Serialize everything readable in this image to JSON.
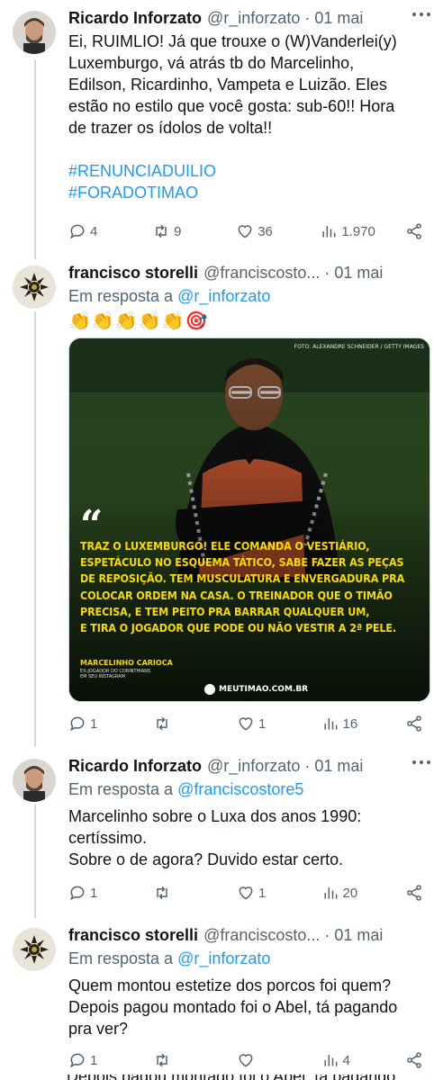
{
  "tweets": [
    {
      "name": "Ricardo Inforzato",
      "handle": "@r_inforzato",
      "date": "01 mai",
      "text": [
        "Ei, RUIMLIO! Já que trouxe o (W)Vanderlei(y)",
        "Luxemburgo, vá atrás tb do Marcelinho,",
        "Edilson, Ricardinho, Vampeta e Luizão. Eles",
        "estão no estilo que você gosta: sub-60!! Hora",
        "de trazer os ídolos de volta!!"
      ],
      "hashtags": [
        "#RENUNCIADUILIO",
        "#FORADOTIMAO"
      ],
      "replies": "4",
      "retweets": "9",
      "likes": "36",
      "views": "1.970"
    },
    {
      "name": "francisco storelli",
      "handle": "@franciscosto...",
      "date": "01 mai",
      "reply_prefix": "Em resposta a",
      "reply_to": "@r_inforzato",
      "emojis": [
        "👏",
        "👏",
        "👏",
        "👏",
        "👏",
        "🎯"
      ],
      "media": {
        "credit": "FOTO: ALEXANDRE SCHNEIDER / GETTY IMAGES",
        "quote_mark": "“",
        "quote_lines": [
          "TRAZ O LUXEMBURGO! ELE COMANDA O VESTIÁRIO,",
          "ESPETÁCULO NO ESQUEMA TÁTICO, SABE FAZER AS PEÇAS",
          "DE REPOSIÇÃO. TEM MUSCULATURA E ENVERGADURA PRA",
          "COLOCAR ORDEM NA CASA. O TREINADOR QUE O TIMÃO",
          "PRECISA, E TEM PEITO PRA BARRAR QUALQUER UM,",
          "E TIRA O JOGADOR QUE PODE OU NÃO VESTIR A 2ª PELE."
        ],
        "author": "MARCELINHO CARIOCA",
        "author_sub1": "EX-JOGADOR DO CORINTHIANS",
        "author_sub2": "EM SEU INSTAGRAM",
        "site": "MEUTIMAO.COM.BR"
      },
      "replies": "1",
      "retweets": "",
      "likes": "1",
      "views": "16"
    },
    {
      "name": "Ricardo Inforzato",
      "handle": "@r_inforzato",
      "date": "01 mai",
      "reply_prefix": "Em resposta a",
      "reply_to": "@franciscostore5",
      "text": [
        "Marcelinho sobre o Luxa dos anos 1990:",
        "certíssimo.",
        "Sobre o de agora? Duvido estar certo."
      ],
      "replies": "1",
      "retweets": "",
      "likes": "1",
      "views": "20"
    },
    {
      "name": "francisco storelli",
      "handle": "@franciscosto...",
      "date": "01 mai",
      "reply_prefix": "Em resposta a",
      "reply_to": "@r_inforzato",
      "text": [
        "Quem montou estetize dos porcos foi quem?",
        "Depois pagou montado foi o Abel,  tá pagando",
        "pra ver?"
      ],
      "replies": "1",
      "retweets": "",
      "likes": "",
      "views": "4"
    }
  ],
  "ghost_text": "Depois pagou montado foi o Abel,  tá pagando",
  "colors": {
    "text": "#0f1419",
    "secondary": "#536471",
    "link": "#1d9bf0",
    "thread_line": "#cfd9de",
    "quote_yellow": "#f5d90a"
  }
}
